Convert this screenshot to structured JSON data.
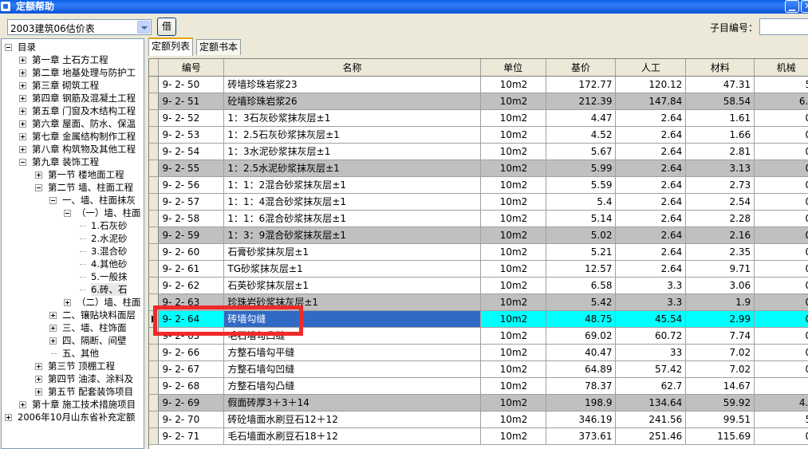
{
  "window": {
    "title": "定额帮助",
    "minimize_glyph": "▁",
    "close_glyph": "✕"
  },
  "toolbar": {
    "dropdown_value": "2003建筑06估价表",
    "button_label": "借",
    "sub_label": "子目编号："
  },
  "tree": {
    "nodes": [
      {
        "label": "目录",
        "level": 0,
        "expander": "minus"
      },
      {
        "label": "第一章  土石方工程",
        "level": 1,
        "expander": "plus"
      },
      {
        "label": "第二章  地基处理与防护工",
        "level": 1,
        "expander": "plus"
      },
      {
        "label": "第三章  砌筑工程",
        "level": 1,
        "expander": "plus"
      },
      {
        "label": "第四章  钢筋及混凝土工程",
        "level": 1,
        "expander": "plus"
      },
      {
        "label": "第五章  门窗及木结构工程",
        "level": 1,
        "expander": "plus"
      },
      {
        "label": "第六章  屋面、防水、保温",
        "level": 1,
        "expander": "plus"
      },
      {
        "label": "第七章  金属结构制作工程",
        "level": 1,
        "expander": "plus"
      },
      {
        "label": "第八章  构筑物及其他工程",
        "level": 1,
        "expander": "plus"
      },
      {
        "label": "第九章  装饰工程",
        "level": 1,
        "expander": "minus"
      },
      {
        "label": "第一节  楼地面工程",
        "level": 2,
        "expander": "plus"
      },
      {
        "label": "第二节  墙、柱面工程",
        "level": 2,
        "expander": "minus"
      },
      {
        "label": "一、墙、柱面抹灰",
        "level": 3,
        "expander": "minus"
      },
      {
        "label": "（一）墙、柱面",
        "level": 4,
        "expander": "minus"
      },
      {
        "label": "1.石灰砂",
        "level": 5,
        "expander": "none"
      },
      {
        "label": "2.水泥砂",
        "level": 5,
        "expander": "none"
      },
      {
        "label": "3.混合砂",
        "level": 5,
        "expander": "none"
      },
      {
        "label": "4.其他砂",
        "level": 5,
        "expander": "none"
      },
      {
        "label": "5.一般抹",
        "level": 5,
        "expander": "none"
      },
      {
        "label": "6.砖、石",
        "level": 5,
        "expander": "none",
        "selected": true
      },
      {
        "label": "（二）墙、柱面",
        "level": 4,
        "expander": "plus"
      },
      {
        "label": "二、镶贴块料面层",
        "level": 3,
        "expander": "plus"
      },
      {
        "label": "三、墙、柱饰面",
        "level": 3,
        "expander": "plus"
      },
      {
        "label": "四、隔断、间壁",
        "level": 3,
        "expander": "plus"
      },
      {
        "label": "五、其他",
        "level": 3,
        "expander": "none"
      },
      {
        "label": "第三节  顶棚工程",
        "level": 2,
        "expander": "plus"
      },
      {
        "label": "第四节  油漆、涂料及",
        "level": 2,
        "expander": "plus"
      },
      {
        "label": "第五节  配套装饰项目",
        "level": 2,
        "expander": "plus"
      },
      {
        "label": "第十章  施工技术措施项目",
        "level": 1,
        "expander": "plus"
      },
      {
        "label": "2006年10月山东省补充定额",
        "level": 0,
        "expander": "plus"
      }
    ]
  },
  "tabs": [
    {
      "label": "定额列表",
      "active": true
    },
    {
      "label": "定额书本",
      "active": false
    }
  ],
  "table": {
    "columns": [
      "编号",
      "名称",
      "单位",
      "基价",
      "人工",
      "材料",
      "机械"
    ],
    "rows": [
      {
        "code": "9- 2- 50",
        "name": "砖墙珍珠岩浆23",
        "unit": "10m2",
        "base": "172.77",
        "labor": "120.12",
        "material": "47.31",
        "machine": "5.",
        "style": "white"
      },
      {
        "code": "9- 2- 51",
        "name": "砼墙珍珠岩浆26",
        "unit": "10m2",
        "base": "212.39",
        "labor": "147.84",
        "material": "58.54",
        "machine": "6.0",
        "style": "gray"
      },
      {
        "code": "9- 2- 52",
        "name": "1：3石灰砂浆抹灰层±1",
        "unit": "10m2",
        "base": "4.47",
        "labor": "2.64",
        "material": "1.61",
        "machine": "0.",
        "style": "white"
      },
      {
        "code": "9- 2- 53",
        "name": "1：2.5石灰砂浆抹灰层±1",
        "unit": "10m2",
        "base": "4.52",
        "labor": "2.64",
        "material": "1.66",
        "machine": "0.",
        "style": "white"
      },
      {
        "code": "9- 2- 54",
        "name": "1：3水泥砂浆抹灰层±1",
        "unit": "10m2",
        "base": "5.67",
        "labor": "2.64",
        "material": "2.81",
        "machine": "0.",
        "style": "white"
      },
      {
        "code": "9- 2- 55",
        "name": "1：2.5水泥砂浆抹灰层±1",
        "unit": "10m2",
        "base": "5.99",
        "labor": "2.64",
        "material": "3.13",
        "machine": "0.",
        "style": "gray"
      },
      {
        "code": "9- 2- 56",
        "name": "1：1：2混合砂浆抹灰层±1",
        "unit": "10m2",
        "base": "5.59",
        "labor": "2.64",
        "material": "2.73",
        "machine": "0.",
        "style": "white"
      },
      {
        "code": "9- 2- 57",
        "name": "1：1：4混合砂浆抹灰层±1",
        "unit": "10m2",
        "base": "5.4",
        "labor": "2.64",
        "material": "2.54",
        "machine": "0.",
        "style": "white"
      },
      {
        "code": "9- 2- 58",
        "name": "1：1：6混合砂浆抹灰层±1",
        "unit": "10m2",
        "base": "5.14",
        "labor": "2.64",
        "material": "2.28",
        "machine": "0.",
        "style": "white"
      },
      {
        "code": "9- 2- 59",
        "name": "1：3：9混合砂浆抹灰层±1",
        "unit": "10m2",
        "base": "5.02",
        "labor": "2.64",
        "material": "2.16",
        "machine": "0.",
        "style": "gray"
      },
      {
        "code": "9- 2- 60",
        "name": "石膏砂浆抹灰层±1",
        "unit": "10m2",
        "base": "5.21",
        "labor": "2.64",
        "material": "2.35",
        "machine": "0.",
        "style": "white"
      },
      {
        "code": "9- 2- 61",
        "name": "TG砂浆抹灰层±1",
        "unit": "10m2",
        "base": "12.57",
        "labor": "2.64",
        "material": "9.71",
        "machine": "0.",
        "style": "white"
      },
      {
        "code": "9- 2- 62",
        "name": "石英砂浆抹灰层±1",
        "unit": "10m2",
        "base": "6.58",
        "labor": "3.3",
        "material": "3.06",
        "machine": "0.",
        "style": "white"
      },
      {
        "code": "9- 2- 63",
        "name": "珍珠岩砂浆抹灰层±1",
        "unit": "10m2",
        "base": "5.42",
        "labor": "3.3",
        "material": "1.9",
        "machine": "0.",
        "style": "gray"
      },
      {
        "code": "9- 2- 64",
        "name": "砖墙勾缝",
        "unit": "10m2",
        "base": "48.75",
        "labor": "45.54",
        "material": "2.99",
        "machine": "0.",
        "style": "highlight"
      },
      {
        "code": "9- 2- 65",
        "name": "毛石墙勾凸缝",
        "unit": "10m2",
        "base": "69.02",
        "labor": "60.72",
        "material": "7.74",
        "machine": "0.",
        "style": "white"
      },
      {
        "code": "9- 2- 66",
        "name": "方整石墙勾平缝",
        "unit": "10m2",
        "base": "40.47",
        "labor": "33",
        "material": "7.02",
        "machine": "0.",
        "style": "white"
      },
      {
        "code": "9- 2- 67",
        "name": "方整石墙勾凹缝",
        "unit": "10m2",
        "base": "64.89",
        "labor": "57.42",
        "material": "7.02",
        "machine": "0.",
        "style": "white"
      },
      {
        "code": "9- 2- 68",
        "name": "方整石墙勾凸缝",
        "unit": "10m2",
        "base": "78.37",
        "labor": "62.7",
        "material": "14.67",
        "machine": "",
        "style": "white"
      },
      {
        "code": "9- 2- 69",
        "name": "假面砖厚3＋3＋14",
        "unit": "10m2",
        "base": "198.9",
        "labor": "134.64",
        "material": "59.92",
        "machine": "4.3",
        "style": "gray"
      },
      {
        "code": "9- 2- 70",
        "name": "砖砼墙面水刷豆石12＋12",
        "unit": "10m2",
        "base": "346.19",
        "labor": "241.56",
        "material": "99.51",
        "machine": "5.",
        "style": "white"
      },
      {
        "code": "9- 2- 71",
        "name": "毛石墙面水刷豆石18＋12",
        "unit": "10m2",
        "base": "373.61",
        "labor": "251.46",
        "material": "115.69",
        "machine": "0.",
        "style": "white"
      }
    ]
  }
}
